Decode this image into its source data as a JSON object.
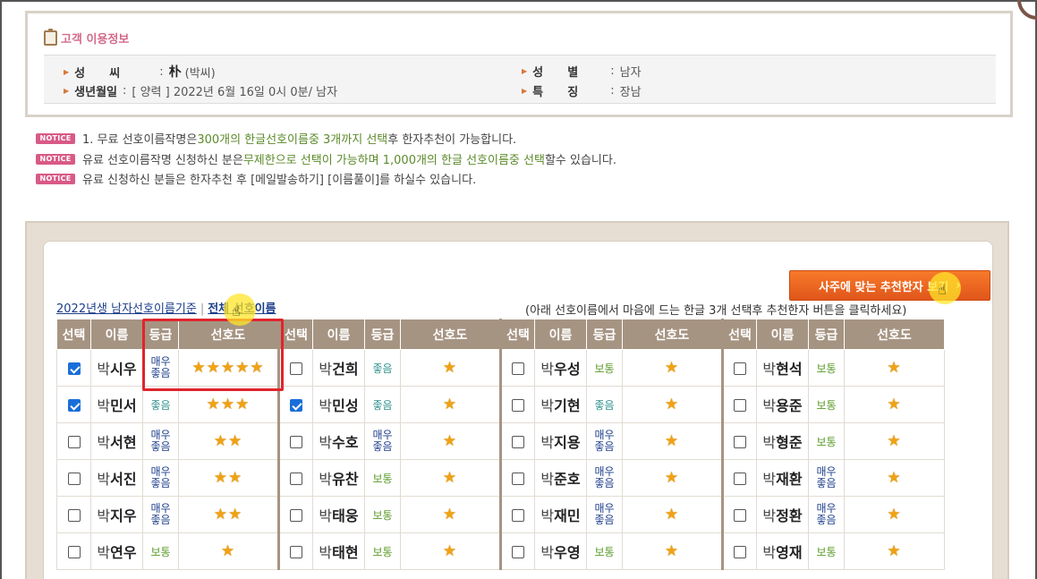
{
  "info": {
    "title": "고객 이용정보",
    "rows": {
      "surname_label": "성      씨",
      "surname_value_hanja": "朴",
      "surname_value_note": "(박씨)",
      "birth_label": "생년월일",
      "birth_value": "[ 양력 ] 2022년 6월 16일 0시 0분/ 남자",
      "gender_label": "성      별",
      "gender_value": "남자",
      "trait_label": "특      징",
      "trait_value": "장남"
    }
  },
  "notices": {
    "badge": "NOTICE",
    "n1_a": "1. 무료 선호이름작명은 ",
    "n1_hl": "300개의 한글선호이름중 3개까지 선택",
    "n1_b": "후 한자추천이 가능합니다.",
    "n2_a": "유료 선호이름작명 신청하신 분은",
    "n2_hl": "무제한으로 선택이 가능하며 1,000개의 한글 선호이름중 선택",
    "n2_b": "할수 있습니다.",
    "n3": "유료 신청하신 분들은 한자추천 후 [메일발송하기] [이름풀이]를 하실수 있습니다."
  },
  "panel": {
    "saju_button": "사주에 맞는 추천한자 보기",
    "link_year": "2022년생 남자선호이름기준",
    "link_sep": "|",
    "link_all": "전체 선호이름",
    "hint": "(아래 선호이름에서 마음에 드는 한글 3개 선택후 추천한자 버튼을 클릭하세요)"
  },
  "table": {
    "headers": {
      "select": "선택",
      "name": "이름",
      "grade": "등급",
      "pref": "선호도"
    },
    "rows": [
      [
        {
          "checked": true,
          "sur": "박",
          "given": "시우",
          "grade": "매우좋음",
          "gclass": "g-best",
          "stars": "★★★★★"
        },
        {
          "checked": false,
          "sur": "박",
          "given": "건희",
          "grade": "좋음",
          "gclass": "g-good",
          "stars": "★"
        },
        {
          "checked": false,
          "sur": "박",
          "given": "우성",
          "grade": "보통",
          "gclass": "g-norm",
          "stars": "★"
        },
        {
          "checked": false,
          "sur": "박",
          "given": "현석",
          "grade": "보통",
          "gclass": "g-norm",
          "stars": "★"
        }
      ],
      [
        {
          "checked": true,
          "sur": "박",
          "given": "민서",
          "grade": "좋음",
          "gclass": "g-good",
          "stars": "★★★"
        },
        {
          "checked": true,
          "sur": "박",
          "given": "민성",
          "grade": "좋음",
          "gclass": "g-good",
          "stars": "★"
        },
        {
          "checked": false,
          "sur": "박",
          "given": "기현",
          "grade": "좋음",
          "gclass": "g-good",
          "stars": "★"
        },
        {
          "checked": false,
          "sur": "박",
          "given": "용준",
          "grade": "보통",
          "gclass": "g-norm",
          "stars": "★"
        }
      ],
      [
        {
          "checked": false,
          "sur": "박",
          "given": "서현",
          "grade": "매우좋음",
          "gclass": "g-best",
          "stars": "★★"
        },
        {
          "checked": false,
          "sur": "박",
          "given": "수호",
          "grade": "매우좋음",
          "gclass": "g-best",
          "stars": "★"
        },
        {
          "checked": false,
          "sur": "박",
          "given": "지용",
          "grade": "매우좋음",
          "gclass": "g-best",
          "stars": "★"
        },
        {
          "checked": false,
          "sur": "박",
          "given": "형준",
          "grade": "보통",
          "gclass": "g-norm",
          "stars": "★"
        }
      ],
      [
        {
          "checked": false,
          "sur": "박",
          "given": "서진",
          "grade": "매우좋음",
          "gclass": "g-best",
          "stars": "★★"
        },
        {
          "checked": false,
          "sur": "박",
          "given": "유찬",
          "grade": "보통",
          "gclass": "g-norm",
          "stars": "★"
        },
        {
          "checked": false,
          "sur": "박",
          "given": "준호",
          "grade": "매우좋음",
          "gclass": "g-best",
          "stars": "★"
        },
        {
          "checked": false,
          "sur": "박",
          "given": "재환",
          "grade": "매우좋음",
          "gclass": "g-best",
          "stars": "★"
        }
      ],
      [
        {
          "checked": false,
          "sur": "박",
          "given": "지우",
          "grade": "매우좋음",
          "gclass": "g-best",
          "stars": "★★"
        },
        {
          "checked": false,
          "sur": "박",
          "given": "태웅",
          "grade": "보통",
          "gclass": "g-norm",
          "stars": "★"
        },
        {
          "checked": false,
          "sur": "박",
          "given": "재민",
          "grade": "매우좋음",
          "gclass": "g-best",
          "stars": "★"
        },
        {
          "checked": false,
          "sur": "박",
          "given": "정환",
          "grade": "매우좋음",
          "gclass": "g-best",
          "stars": "★"
        }
      ],
      [
        {
          "checked": false,
          "sur": "박",
          "given": "연우",
          "grade": "보통",
          "gclass": "g-norm",
          "stars": "★"
        },
        {
          "checked": false,
          "sur": "박",
          "given": "태현",
          "grade": "보통",
          "gclass": "g-norm",
          "stars": "★"
        },
        {
          "checked": false,
          "sur": "박",
          "given": "우영",
          "grade": "보통",
          "gclass": "g-norm",
          "stars": "★"
        },
        {
          "checked": false,
          "sur": "박",
          "given": "영재",
          "grade": "보통",
          "gclass": "g-norm",
          "stars": "★"
        }
      ]
    ]
  },
  "colors": {
    "header_bg": "#a69482",
    "accent_orange": "#f06c22",
    "notice_pink": "#d85a86",
    "highlight_red": "#e0242c"
  }
}
